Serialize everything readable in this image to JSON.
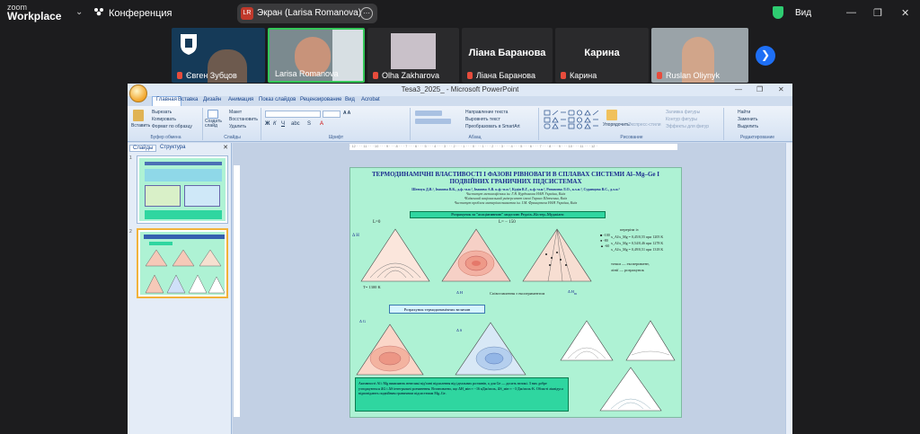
{
  "zoom": {
    "logo_line1": "zoom",
    "logo_line2": "Workplace",
    "meeting_label": "Конференция",
    "share_badge": "LR",
    "share_label": "Экран (Larisa Romanova)",
    "view_label": "Вид",
    "next_icon": "chevron-right-icon"
  },
  "participants": [
    {
      "name": "Євген Зубцов",
      "muted": true,
      "type": "avatar"
    },
    {
      "name": "Larisa Romanova",
      "muted": false,
      "type": "video",
      "active_speaker": true
    },
    {
      "name": "Olha Zakharova",
      "muted": true,
      "type": "video"
    },
    {
      "name": "Ліана Баранова",
      "muted": true,
      "type": "name",
      "big_name": "Ліана Баранова"
    },
    {
      "name": "Карина",
      "muted": true,
      "type": "name",
      "big_name": "Карина"
    },
    {
      "name": "Ruslan Oliynyk",
      "muted": true,
      "type": "video"
    }
  ],
  "ppt": {
    "window_title": "Tesa3_2025_ - Microsoft PowerPoint",
    "tabs": [
      "Главная",
      "Вставка",
      "Дизайн",
      "Анимация",
      "Показ слайдов",
      "Рецензирование",
      "Вид",
      "Acrobat"
    ],
    "active_tab": "Главная",
    "ribbon": {
      "paste": "Вставить",
      "cut": "Вырезать",
      "copy": "Копировать",
      "format_painter": "Формат по образцу",
      "clipboard_group": "Буфер обмена",
      "new_slide": "Создать слайд",
      "layout": "Макет",
      "reset": "Восстановить",
      "delete": "Удалить",
      "slides_group": "Слайды",
      "font_group": "Шрифт",
      "text_direction": "Направление текста",
      "align_text": "Выровнять текст",
      "smartart": "Преобразовать в SmartArt",
      "paragraph_group": "Абзац",
      "arrange": "Упорядочить",
      "quick_styles": "Экспресс-стили",
      "shape_fill": "Заливка фигуры",
      "shape_outline": "Контур фигуры",
      "shape_effects": "Эффекты для фигур",
      "drawing_group": "Рисование",
      "find": "Найти",
      "replace": "Заменить",
      "select": "Выделить",
      "editing_group": "Редактирование"
    },
    "left_tabs": [
      "Слайды",
      "Структура"
    ],
    "slide_numbers": [
      "1",
      "2"
    ],
    "ruler_text": "· 12 · · · 11 · · · 10 · · · 9 · · · 8 · · · 7 · · · 6 · · · 5 · · · 4 · · · 3 · · · 2 · · · 1 · · · 0 · · · 1 · · · 2 · · · 3 · · · 4 · · · 5 · · · 6 · · · 7 · · · 8 · · · 9 · · · 10 · · · 11 · · · 12 ·"
  },
  "slide": {
    "title": "ТЕРМОДИНАМІЧНІ ВЛАСТИВОСТІ І ФАЗОВІ РІВНОВАГИ В СПЛАВАХ СИСТЕМИ Al–Mg–Ge І ПОДВІЙНИХ ГРАНИЧНИХ ПІДСИСТЕМАХ",
    "authors": "Шевчук Д.В.¹, Іванова В.К., д.ф.-м.н.², Іванова А.В. к.ф.-м.н.², Кудін В.Г., к.ф.-м.н.², Романова Л.О., к.х.н.³, Судавцова В.С., д.х.н.³",
    "aff1": "¹Інститут металофізики ім. Г.В. Курдюмова НАН України, Київ",
    "aff2": "²Київський національний університет імені Тараса Шевченка, Київ",
    "aff3": "³Інститут проблем матеріалознавства ім. І.М. Францевича НАН України, Київ",
    "calc_box": "Розрахунок за \"асоціативною\" моделлю Редліх–Кістер–Муджіанс",
    "l0": "L=0",
    "l150": "L= − 150",
    "dh1": "Δ H",
    "temp": "T= 1300 K",
    "dh2": "Δ H",
    "compare": "Співставлення з експериментом",
    "dh3": "Δ H",
    "sub_m": "m",
    "legend": [
      "-100",
      "-80",
      "-60"
    ],
    "intersections": "перерізи із",
    "sec1": "x_Al/x_Mg = 0,45/0,55 при 1205 K",
    "sec2": "x_Al/x_Mg = 0,54/0,46 при 1278 K",
    "sec3": "x_Al/x_Mg = 0,49/0,51 при 1318 K",
    "points": "точки — експеримент,",
    "lines": "лінії — розрахунок",
    "thermo_box": "Розрахунок термодинамічних величин",
    "dg": "Δ G",
    "ds": "Δ S",
    "bottom": "Активності Al і Mg виявляють невеликі від'ємні відхилення від ідеальних розчинів, а для Ge — досить великі. З них добре узгоджуються ΔG і ΔS інтегральні розчинення. Встановлено, що ΔH_мін ≈ −16 кДж/моль, ΔS_мін ≈ −3 Дж/моль·K. Області ліквідуса відповідають подвійним граничним підсистемам Mg–Ge."
  }
}
